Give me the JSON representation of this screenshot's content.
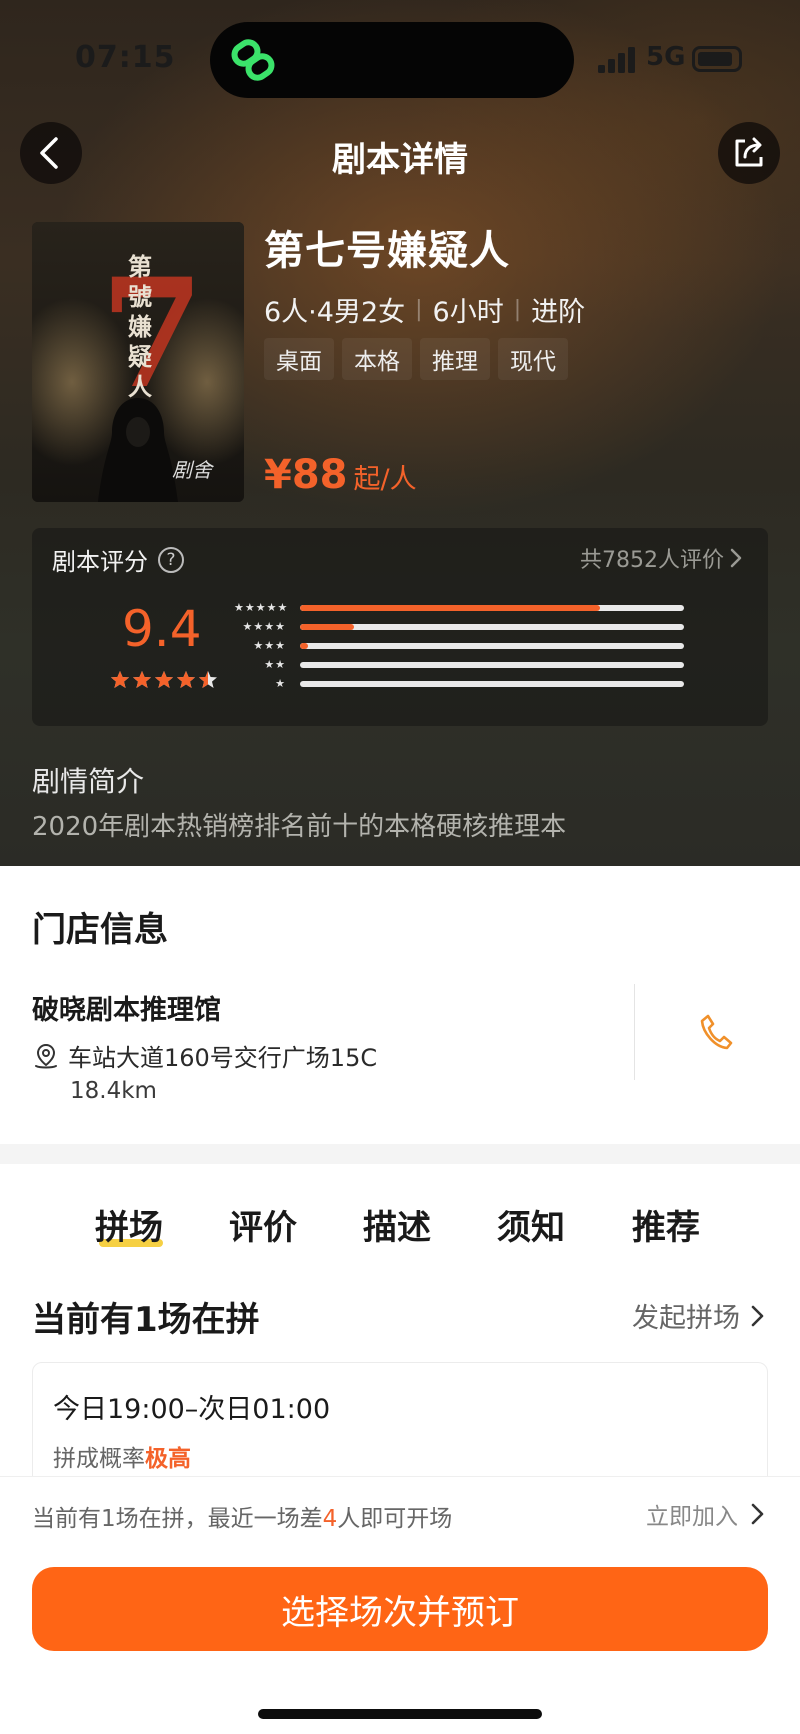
{
  "status": {
    "time": "07:15",
    "network": "5G"
  },
  "nav": {
    "title": "剧本详情"
  },
  "script": {
    "poster_title": "第號嫌疑人",
    "poster_numeral": "7",
    "poster_signature": "剧舍",
    "title": "第七号嫌疑人",
    "players": "6人·4男2女",
    "duration": "6小时",
    "level": "进阶",
    "tags": [
      "桌面",
      "本格",
      "推理",
      "现代"
    ],
    "price": "¥88",
    "price_unit": "起/人"
  },
  "rating": {
    "label": "剧本评分",
    "help": "?",
    "review_count": "共7852人评价",
    "score": "9.4",
    "stars": 4.5,
    "distribution": [
      {
        "stars": "★★★★★",
        "fraction": 0.78
      },
      {
        "stars": "★★★★",
        "fraction": 0.14
      },
      {
        "stars": "★★★",
        "fraction": 0.02
      },
      {
        "stars": "★★",
        "fraction": 0.0
      },
      {
        "stars": "★",
        "fraction": 0.0
      }
    ]
  },
  "synopsis": {
    "title": "剧情简介",
    "text": "2020年剧本热销榜排名前十的本格硬核推理本"
  },
  "store": {
    "heading": "门店信息",
    "name": "破晓剧本推理馆",
    "address": "车站大道160号交行广场15C",
    "distance": "18.4km"
  },
  "tabs": [
    "拼场",
    "评价",
    "描述",
    "须知",
    "推荐"
  ],
  "sessions": {
    "heading": "当前有1场在拼",
    "start_link": "发起拼场",
    "card": {
      "time": "今日19:00–次日01:00",
      "prob_label": "拼成概率",
      "prob_value": "极高"
    }
  },
  "bottom": {
    "notice_prefix": "当前有1场在拼，最近一场差",
    "notice_num": "4",
    "notice_suffix": "人即可开场",
    "join": "立即加入",
    "book": "选择场次并预订"
  },
  "colors": {
    "accent": "#f4622a",
    "button": "#ff6515",
    "tab_underline": "#f6d043"
  }
}
